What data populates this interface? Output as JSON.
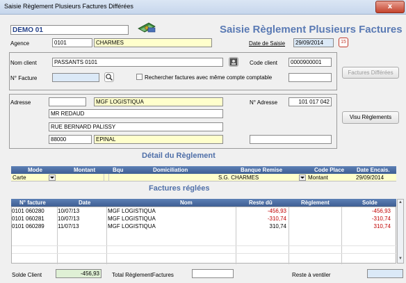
{
  "window": {
    "title": "Saisie Règlement Plusieurs Factures Différées",
    "close_label": "x"
  },
  "header": {
    "company_code": "DEMO 01",
    "page_title": "Saisie Règlement Plusieurs Factures"
  },
  "agence": {
    "label": "Agence",
    "code": "0101",
    "name": "CHARMES"
  },
  "date_saisie": {
    "label": "Date de Saisie",
    "value": "29/09/2014",
    "button": "15"
  },
  "client": {
    "nom_label": "Nom client",
    "nom_value": "PASSANTS 0101",
    "code_label": "Code client",
    "code_value": "0000900001",
    "facture_label": "N° Facture",
    "facture_value": "",
    "search_checkbox_label": "Rechercher factures avec même compte comptable"
  },
  "buttons": {
    "factures_differees": "Factures Différées",
    "visu_reglements": "Visu Règlements"
  },
  "adresse": {
    "label": "Adresse",
    "name": "MGF LOGISTIQUA",
    "line1": "MR REDAUD",
    "line2": "RUE BERNARD PALISSY",
    "postcode": "88000",
    "city": "EPINAL",
    "numero_label": "N° Adresse",
    "numero_value": "101 017 042"
  },
  "detail": {
    "title": "Détail du Règlement",
    "columns": [
      "Mode",
      "Montant",
      "Bqu",
      "Domiciliation",
      "Banque Remise",
      "Code Place",
      "Date Encais."
    ],
    "row": {
      "mode": "Carte",
      "montant": "",
      "bqu": "",
      "domiciliation": "",
      "banque_remise": "S.G. CHARMES",
      "code_place": "Montant",
      "date_encais": "29/09/2014"
    }
  },
  "factures": {
    "title": "Factures réglées",
    "columns": [
      "N° facture",
      "Date",
      "Nom",
      "Reste dû",
      "Règlement",
      "Solde"
    ],
    "rows": [
      {
        "numero": "0101 060280",
        "date": "10/07/13",
        "nom": "MGF LOGISTIQUA",
        "reste_du": "-456,93",
        "reglement": "",
        "solde": "-456,93"
      },
      {
        "numero": "0101 060281",
        "date": "10/07/13",
        "nom": "MGF LOGISTIQUA",
        "reste_du": "-310,74",
        "reglement": "",
        "solde": "-310,74"
      },
      {
        "numero": "0101 060289",
        "date": "11/07/13",
        "nom": "MGF LOGISTIQUA",
        "reste_du": "310,74",
        "reglement": "",
        "solde": "310,74"
      }
    ]
  },
  "footer": {
    "solde_client_label": "Solde Client",
    "solde_client_value": "-456,93",
    "total_label": "Total RèglementFactures",
    "total_value": "",
    "reste_label": "Reste à ventiler",
    "reste_value": ""
  },
  "colors": {
    "accent": "#4f6fa8",
    "header_bar": "#4a6ba1",
    "input_yellow": "#ffffcc",
    "input_blue": "#dbe9f7",
    "negative": "#c00000"
  }
}
